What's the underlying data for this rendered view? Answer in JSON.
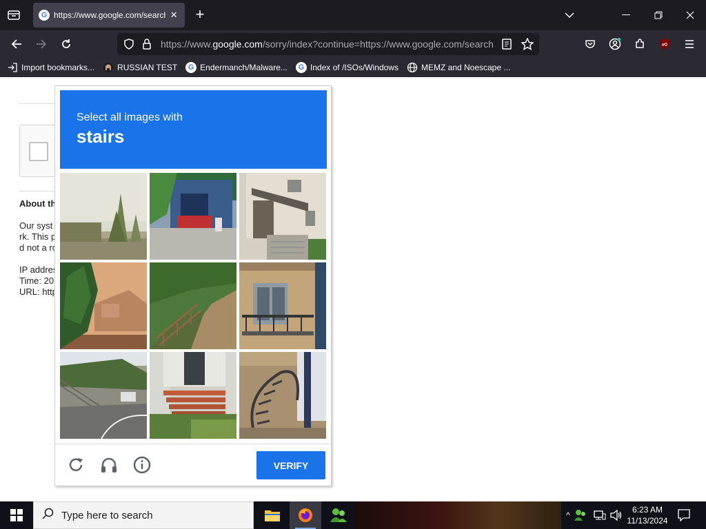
{
  "browser": {
    "tab": {
      "title": "https://www.google.com/search?q=",
      "favicon": "google-g-icon"
    },
    "url": {
      "prefix": "https://www.",
      "domain": "google.com",
      "rest": "/sorry/index?continue=https://www.google.com/search"
    },
    "bookmarks": [
      {
        "label": "Import bookmarks...",
        "icon": "import-icon"
      },
      {
        "label": "RUSSIAN TEST",
        "icon": "github-icon"
      },
      {
        "label": "Endermanch/Malware...",
        "icon": "google-g-icon"
      },
      {
        "label": "Index of /ISOs/Windows",
        "icon": "google-g-icon"
      },
      {
        "label": "MEMZ and Noescape ...",
        "icon": "globe-icon"
      }
    ]
  },
  "page": {
    "about_heading": "About th",
    "lines": [
      "Our syst",
      "rk. This p",
      "d not a ro",
      "IP addres",
      "Time: 20",
      "URL: http"
    ]
  },
  "captcha": {
    "instruction": "Select all images with",
    "object": "stairs",
    "verify_label": "VERIFY",
    "header_color": "#1a73e8",
    "tiles": [
      "park-trees",
      "building-entrance",
      "house-porch",
      "orange-house-tree",
      "wooden-railing-path",
      "apartment-balcony",
      "hillside-road-stairs",
      "brick-steps",
      "spiral-staircase"
    ]
  },
  "taskbar": {
    "search_placeholder": "Type here to search",
    "time": "6:23 AM",
    "date": "11/13/2024"
  }
}
